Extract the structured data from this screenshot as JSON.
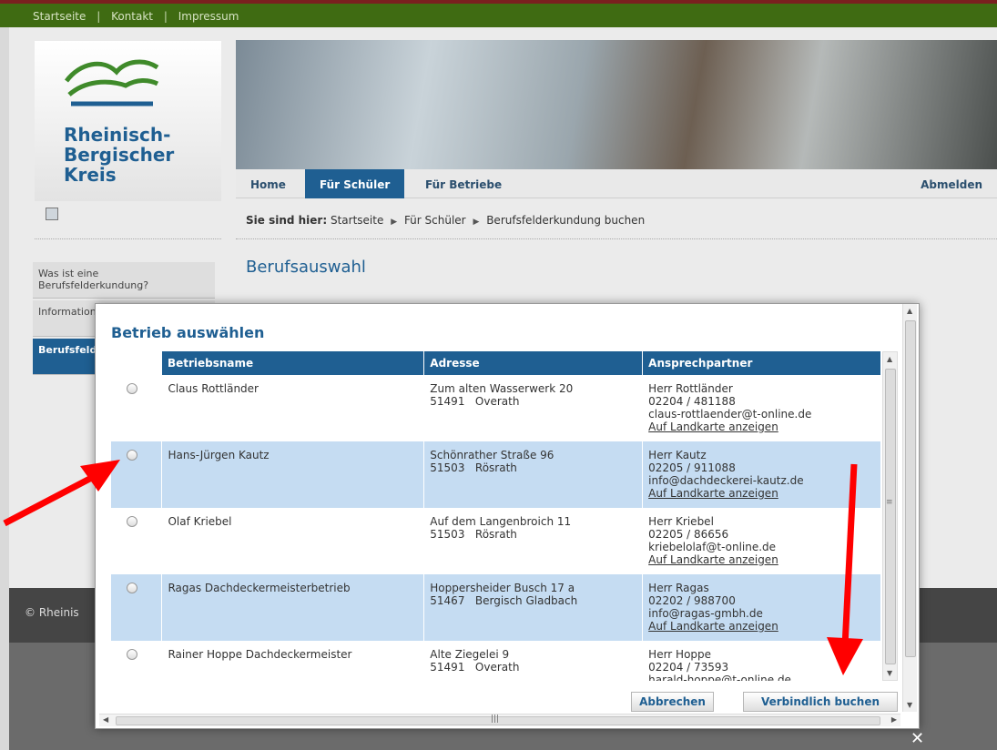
{
  "topbar": {
    "links": [
      "Startseite",
      "Kontakt",
      "Impressum"
    ]
  },
  "logo": {
    "line1": "Rheinisch-",
    "line2": "Bergischer",
    "line3": "Kreis"
  },
  "nav": {
    "home": "Home",
    "students": "Für Schüler",
    "companies": "Für Betriebe",
    "logout": "Abmelden"
  },
  "breadcrumb": {
    "prefix": "Sie sind hier:",
    "items": [
      "Startseite",
      "Für Schüler",
      "Berufsfelderkundung buchen"
    ]
  },
  "page_title": "Berufsauswahl",
  "sidebar": {
    "items": [
      {
        "label": "Was ist eine Berufsfelderkundung?"
      },
      {
        "label": "Information Berufsfelde"
      },
      {
        "label": "Berufsfeld buchen"
      }
    ]
  },
  "footer": {
    "copyright": "© Rheinis"
  },
  "modal": {
    "title": "Betrieb auswählen",
    "columns": [
      "Betriebsname",
      "Adresse",
      "Ansprechpartner"
    ],
    "rows": [
      {
        "name": "Claus Rottländer",
        "address1": "Zum alten Wasserwerk 20",
        "address2": "51491   Overath",
        "contact": "Herr Rottländer",
        "phone": "02204 / 481188",
        "email": "claus-rottlaender@t-online.de",
        "map": "Auf Landkarte anzeigen"
      },
      {
        "name": "Hans-Jürgen Kautz",
        "address1": "Schönrather Straße 96",
        "address2": "51503   Rösrath",
        "contact": "Herr Kautz",
        "phone": "02205 / 911088",
        "email": "info@dachdeckerei-kautz.de",
        "map": "Auf Landkarte anzeigen"
      },
      {
        "name": "Olaf Kriebel",
        "address1": "Auf dem Langenbroich 11",
        "address2": "51503   Rösrath",
        "contact": "Herr Kriebel",
        "phone": "02205 / 86656",
        "email": "kriebelolaf@t-online.de",
        "map": "Auf Landkarte anzeigen"
      },
      {
        "name": "Ragas Dachdeckermeisterbetrieb",
        "address1": "Hoppersheider Busch 17 a",
        "address2": "51467   Bergisch Gladbach",
        "contact": "Herr Ragas",
        "phone": "02202 / 988700",
        "email": "info@ragas-gmbh.de",
        "map": "Auf Landkarte anzeigen"
      },
      {
        "name": "Rainer Hoppe Dachdeckermeister",
        "address1": "Alte Ziegelei 9",
        "address2": "51491   Overath",
        "contact": "Herr Hoppe",
        "phone": "02204 / 73593",
        "email": "harald-hoppe@t-online.de",
        "map": ""
      }
    ],
    "cancel": "Abbrechen",
    "book": "Verbindlich buchen",
    "close": "✕"
  },
  "colors": {
    "brand_blue": "#1f5f92",
    "topbar_green": "#3f6b12",
    "row_highlight": "#c5dcf2",
    "annotation_arrow": "#ff0000"
  }
}
